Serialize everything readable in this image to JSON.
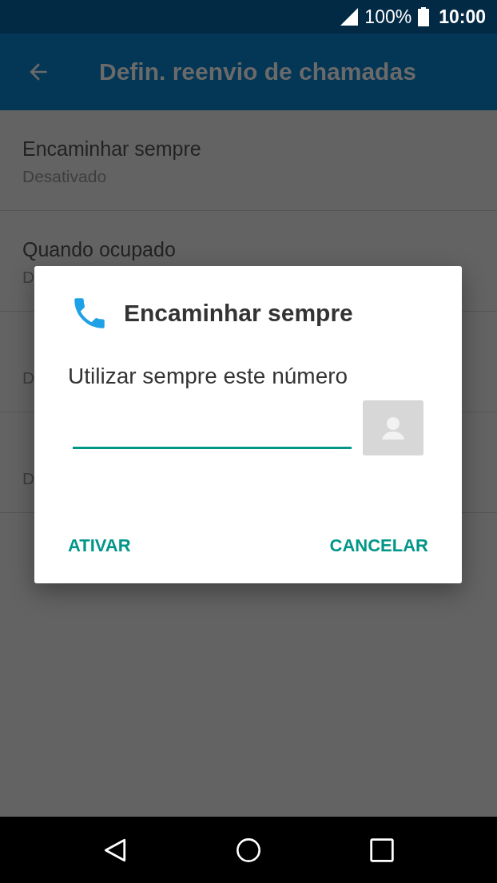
{
  "status_bar": {
    "battery": "100%",
    "time": "10:00"
  },
  "app_bar": {
    "title": "Defin. reenvio de chamadas"
  },
  "settings": [
    {
      "title": "Encaminhar sempre",
      "summary": "Desativado"
    },
    {
      "title": "Quando ocupado",
      "summary": "D"
    },
    {
      "summary": "D"
    },
    {
      "summary": "D"
    }
  ],
  "dialog": {
    "title": "Encaminhar sempre",
    "message": "Utilizar sempre este número",
    "field": {
      "focused": true
    },
    "buttons": [
      {
        "label": "ATIVAR"
      },
      {
        "label": "CANCELAR"
      }
    ]
  }
}
